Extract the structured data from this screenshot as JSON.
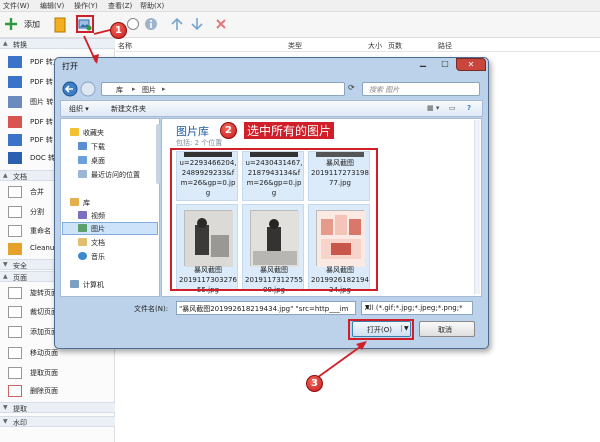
{
  "menu": [
    "文件(W)",
    "编辑(V)",
    "操作(Y)",
    "查看(Z)",
    "帮助(X)"
  ],
  "toolbar": {
    "add_label": "添加"
  },
  "list_headers": {
    "name": "名称",
    "type": "类型",
    "size": "大小",
    "pages": "页数",
    "path": "路径"
  },
  "sidebar": {
    "sections": {
      "convert": "转换",
      "doc": "文档",
      "security": "安全",
      "page": "页面",
      "extract": "提取",
      "watermark": "水印"
    },
    "convert_items": [
      "PDF 转文本",
      "PDF 转",
      "图片 转",
      "PDF 转",
      "PDF 转",
      "DOC 转"
    ],
    "doc_items": [
      "合并",
      "分割",
      "重命名",
      "Cleanu"
    ],
    "page_items": [
      "旋转页面",
      "裁切页面",
      "添加页面",
      "移动页面",
      "提取页面",
      "删除页面"
    ]
  },
  "dialog": {
    "title": "打开",
    "breadcrumb": [
      "库",
      "图片"
    ],
    "search_placeholder": "搜索 图片",
    "commands": {
      "organize": "组织 ▾",
      "new_folder": "新建文件夹"
    },
    "nav": {
      "favorites": "收藏夹",
      "favorite_items": [
        "下载",
        "桌面",
        "最近访问的位置"
      ],
      "library": "库",
      "library_items": [
        "视频",
        "图片",
        "文档",
        "音乐"
      ],
      "computer": "计算机"
    },
    "library_title": "图片库",
    "library_subtitle": "包括: 2 个位置",
    "files": [
      "u=2293466204,\n2489929233&f\nm=26&gp=0.jp\ng",
      "u=2430431467,\n2187943134&f\nm=26&gp=0.jp\ng",
      "暴风截图\n2019117273198\n77.jpg",
      "暴风截图\n2019117303276\n55.jpg",
      "暴风截图\n2019117312755\n08.jpg",
      "暴风截图\n2019926182194\n34.jpg"
    ],
    "filename_label": "文件名(N):",
    "filename_value": "\"暴风截图201992618219434.jpg\" \"src=http___im",
    "filetype": "All (*.gif;*.jpg;*.jpeg;*.png;*.b",
    "open_label": "打开(O)",
    "cancel_label": "取消"
  },
  "annotations": {
    "step1": "1",
    "step2": "2",
    "step3": "3",
    "step2_text": "选中所有的图片"
  },
  "colors": {
    "accent_red": "#d01f28",
    "dialog_frame": "#bcd2ea",
    "link_blue": "#1e5aa0"
  }
}
